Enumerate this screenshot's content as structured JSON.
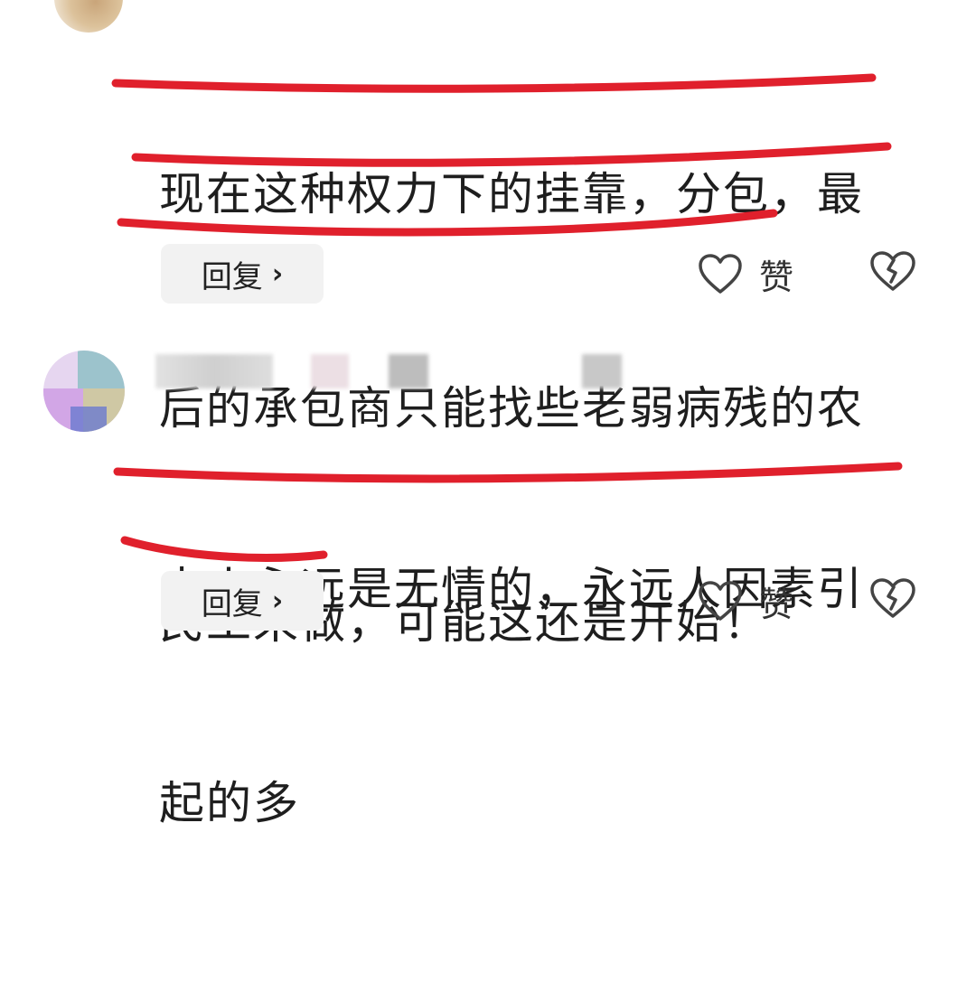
{
  "comments": [
    {
      "lines": [
        "现在这种权力下的挂靠，分包，最",
        "后的承包商只能找些老弱病残的农",
        "民工来做，可能这还是开始！"
      ],
      "reply_label": "回复",
      "like_label": "赞"
    },
    {
      "lines": [
        "水火永远是无情的，永远人因素引",
        "起的多"
      ],
      "reply_label": "回复",
      "like_label": "赞"
    }
  ],
  "colors": {
    "underline": "#e0202c",
    "reply_bg": "#f2f2f2",
    "icon_stroke": "#444444"
  },
  "icons": {
    "reply_chevron": "chevron-right-icon",
    "like": "heart-outline-icon",
    "dislike": "broken-heart-icon"
  }
}
